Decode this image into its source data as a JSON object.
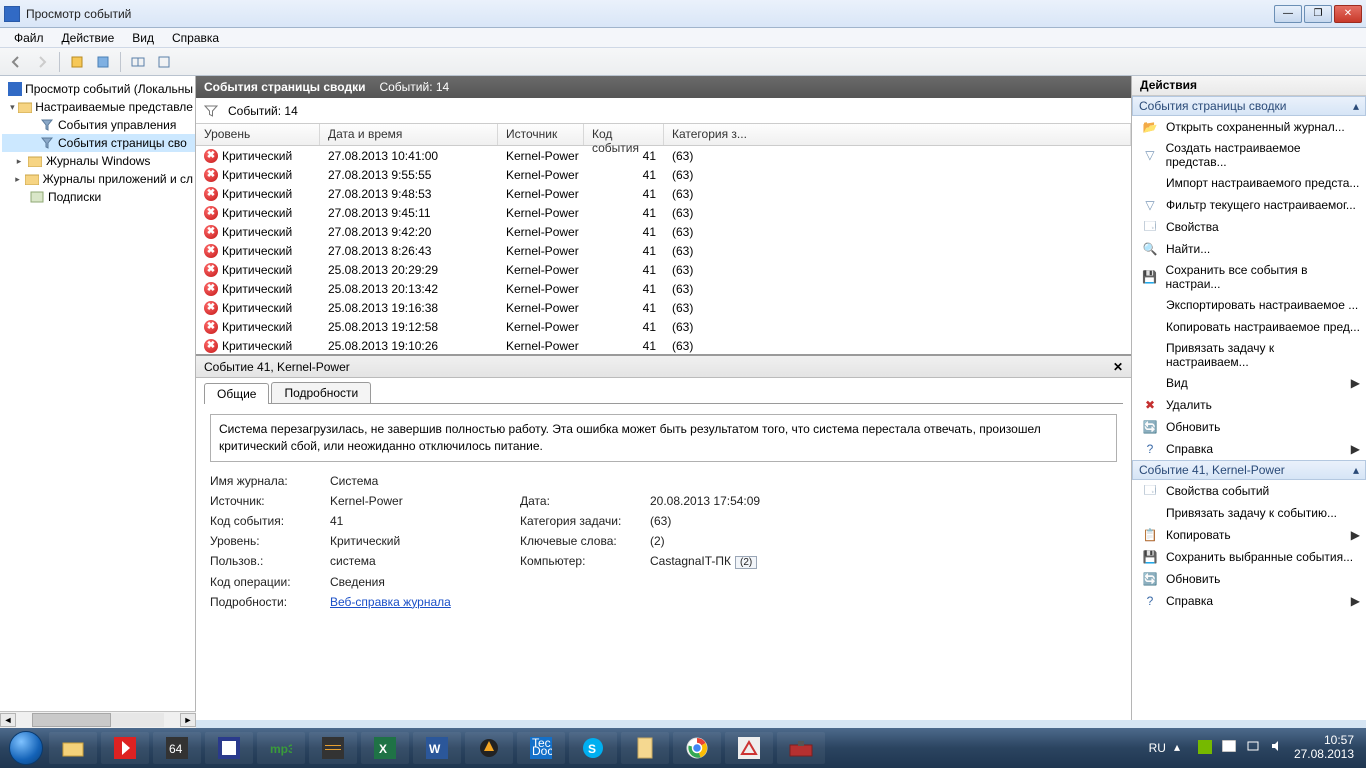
{
  "window": {
    "title": "Просмотр событий"
  },
  "menu": {
    "file": "Файл",
    "action": "Действие",
    "view": "Вид",
    "help": "Справка"
  },
  "tree": {
    "root": "Просмотр событий (Локальны",
    "custom": "Настраиваемые представле",
    "admin": "События управления",
    "summary": "События страницы сво",
    "winlogs": "Журналы Windows",
    "applogs": "Журналы приложений и сл",
    "subs": "Подписки"
  },
  "center": {
    "header_title": "События страницы сводки",
    "header_count": "Событий: 14",
    "filter_count": "Событий: 14",
    "columns": {
      "level": "Уровень",
      "datetime": "Дата и время",
      "source": "Источник",
      "eventid": "Код события",
      "category": "Категория з..."
    },
    "rows": [
      {
        "level": "Критический",
        "dt": "27.08.2013 10:41:00",
        "src": "Kernel-Power",
        "id": "41",
        "cat": "(63)"
      },
      {
        "level": "Критический",
        "dt": "27.08.2013 9:55:55",
        "src": "Kernel-Power",
        "id": "41",
        "cat": "(63)"
      },
      {
        "level": "Критический",
        "dt": "27.08.2013 9:48:53",
        "src": "Kernel-Power",
        "id": "41",
        "cat": "(63)"
      },
      {
        "level": "Критический",
        "dt": "27.08.2013 9:45:11",
        "src": "Kernel-Power",
        "id": "41",
        "cat": "(63)"
      },
      {
        "level": "Критический",
        "dt": "27.08.2013 9:42:20",
        "src": "Kernel-Power",
        "id": "41",
        "cat": "(63)"
      },
      {
        "level": "Критический",
        "dt": "27.08.2013 8:26:43",
        "src": "Kernel-Power",
        "id": "41",
        "cat": "(63)"
      },
      {
        "level": "Критический",
        "dt": "25.08.2013 20:29:29",
        "src": "Kernel-Power",
        "id": "41",
        "cat": "(63)"
      },
      {
        "level": "Критический",
        "dt": "25.08.2013 20:13:42",
        "src": "Kernel-Power",
        "id": "41",
        "cat": "(63)"
      },
      {
        "level": "Критический",
        "dt": "25.08.2013 19:16:38",
        "src": "Kernel-Power",
        "id": "41",
        "cat": "(63)"
      },
      {
        "level": "Критический",
        "dt": "25.08.2013 19:12:58",
        "src": "Kernel-Power",
        "id": "41",
        "cat": "(63)"
      },
      {
        "level": "Критический",
        "dt": "25.08.2013 19:10:26",
        "src": "Kernel-Power",
        "id": "41",
        "cat": "(63)"
      }
    ]
  },
  "detail": {
    "title": "Событие 41, Kernel-Power",
    "tab_general": "Общие",
    "tab_details": "Подробности",
    "description": "Система перезагрузилась, не завершив полностью работу. Эта ошибка может быть результатом того, что система перестала отвечать, произошел критический сбой, или неожиданно отключилось питание.",
    "labels": {
      "logname": "Имя журнала:",
      "source": "Источник:",
      "eventid": "Код события:",
      "level": "Уровень:",
      "user": "Пользов.:",
      "opcode": "Код операции:",
      "moreinfo": "Подробности:",
      "date": "Дата:",
      "category": "Категория задачи:",
      "keywords": "Ключевые слова:",
      "computer": "Компьютер:"
    },
    "values": {
      "logname": "Система",
      "source": "Kernel-Power",
      "eventid": "41",
      "level": "Критический",
      "user": "система",
      "opcode": "Сведения",
      "date": "20.08.2013 17:54:09",
      "category": "(63)",
      "keywords": "(2)",
      "computer": "CastagnaIT-ПК",
      "computer_badge": "(2)",
      "helplink": "Веб-справка журнала"
    }
  },
  "actions": {
    "header": "Действия",
    "section1": "События страницы сводки",
    "items1": [
      "Открыть сохраненный журнал...",
      "Создать настраиваемое представ...",
      "Импорт настраиваемого предста...",
      "Фильтр текущего настраиваемог...",
      "Свойства",
      "Найти...",
      "Сохранить все события в настраи...",
      "Экспортировать настраиваемое ...",
      "Копировать настраиваемое пред...",
      "Привязать задачу к настраиваем...",
      "Вид",
      "Удалить",
      "Обновить",
      "Справка"
    ],
    "section2": "Событие 41, Kernel-Power",
    "items2": [
      "Свойства событий",
      "Привязать задачу к событию...",
      "Копировать",
      "Сохранить выбранные события...",
      "Обновить",
      "Справка"
    ]
  },
  "taskbar": {
    "lang": "RU",
    "time": "10:57",
    "date": "27.08.2013"
  }
}
